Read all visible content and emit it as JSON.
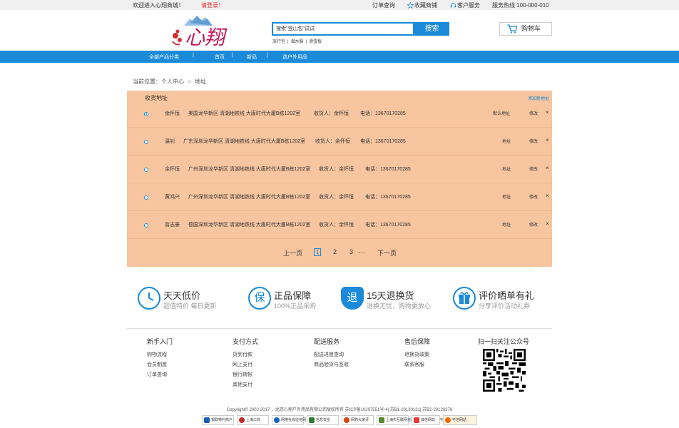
{
  "topbar": {
    "welcome": "欢迎进入心翔商城！",
    "login": "请登录！",
    "order_query": "订单查询",
    "favorite": "收藏商铺",
    "service": "客户服务",
    "hotline": "服务热线 100-000-010"
  },
  "header": {
    "logo_text": "心翔",
    "search_value": "搜索\"登山包\"试试",
    "search_button": "搜索",
    "hot_keywords": [
      "旅行包",
      "|",
      "潜水服",
      "|",
      "滑雪板"
    ],
    "cart_label": "购物车"
  },
  "nav": {
    "items": [
      "全部产品分类",
      "首页",
      "新品",
      "选户外用品"
    ]
  },
  "breadcrumb": {
    "label": "当前位置：个人中心",
    "sep": ">",
    "current": "地址"
  },
  "address": {
    "title": "收货地址",
    "add_label": "添加新地址",
    "rows": [
      {
        "name": "余怀恒",
        "address": "美国龙华新区 清湖地铁线 大唐时代大厦B栋1202室",
        "receiver": "收货人：余怀恒",
        "phone": "电话：13670170285",
        "type": "默认地址",
        "edit": "修改",
        "delete": "×",
        "selected": true
      },
      {
        "name": "温钊",
        "address": "广东深圳龙华新区 清湖地铁线 大唐时代大厦B栋1202室",
        "receiver": "收货人：余怀恒",
        "phone": "电话：13670170285",
        "type": "地址",
        "edit": "修改",
        "delete": "×",
        "selected": false
      },
      {
        "name": "余怀恒",
        "address": "广州深圳龙华新区 清湖地铁线 大唐时代大厦B栋1202室",
        "receiver": "收货人：余怀恒",
        "phone": "电话：13670170285",
        "type": "地址",
        "edit": "修改",
        "delete": "×",
        "selected": false
      },
      {
        "name": "黄鸿兴",
        "address": "广州深圳龙华新区 清湖地铁线 大唐时代大厦B栋1202室",
        "receiver": "收货人：余怀恒",
        "phone": "电话：13670170285",
        "type": "地址",
        "edit": "修改",
        "delete": "×",
        "selected": false
      },
      {
        "name": "曾志豪",
        "address": "德国深圳龙华新区 清湖地铁线 大唐时代大厦B栋1202室",
        "receiver": "收货人：余怀恒",
        "phone": "电话：13670170285",
        "type": "地址",
        "edit": "修改",
        "delete": "×",
        "selected": false
      }
    ]
  },
  "pager": {
    "prev": "上一页",
    "pages": [
      "1",
      "2",
      "3"
    ],
    "ellipsis": "···",
    "next": "下一页",
    "current": "1"
  },
  "services": [
    {
      "icon": "clock-icon",
      "title": "天天低价",
      "sub": "超值特价 每日更新"
    },
    {
      "icon": "guarantee-icon",
      "glyph": "保",
      "title": "正品保障",
      "sub": "100%正品采购"
    },
    {
      "icon": "return-icon",
      "glyph": "退",
      "title": "15天退换货",
      "sub": "退换无忧，购物更放心"
    },
    {
      "icon": "gift-icon",
      "title": "评价晒单有礼",
      "sub": "分享评价活动礼券"
    }
  ],
  "footer": {
    "columns": [
      {
        "title": "新手入门",
        "links": [
          "购物流程",
          "会员制度",
          "订单查询"
        ]
      },
      {
        "title": "支付方式",
        "links": [
          "货到付款",
          "网上支付",
          "银行转帐",
          "其他支付"
        ]
      },
      {
        "title": "配送服务",
        "links": [
          "配送进度查询",
          "商品验货与签收"
        ]
      },
      {
        "title": "售后保障",
        "links": [
          "退换货政策",
          "联系客服"
        ]
      }
    ],
    "qr_title": "扫一扫关注公众号",
    "copyright": "Copyright© 2002-2017 ，北京心翔户外用品有限公司版权所有 苏ICP备10207551号-4| 苏B1-20130131| 苏B2-20130376",
    "badges": [
      "银联特约商户",
      "上海工商",
      "网络社会征信网",
      "信息安全",
      "网购大家评",
      "上海市互联网违法和不良信息举报中心",
      "诚信网站",
      "可信网站"
    ]
  },
  "colors": {
    "accent": "#1a8ad9",
    "panel": "#f7c59f",
    "login": "#e0262a"
  }
}
